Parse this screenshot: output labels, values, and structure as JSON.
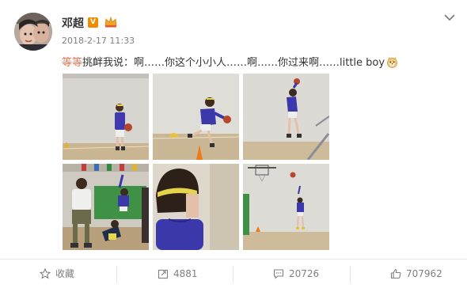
{
  "post": {
    "author": "邓超",
    "verified_badge": "V",
    "timestamp": "2018-2-17 11:33",
    "mention": "等等",
    "text": "挑衅我说：啊……你这个小小人……啊……你过来啊……little boy",
    "colors": {
      "mention": "#eb7350",
      "badge": "#f08a00",
      "text": "#333333",
      "meta": "#808080"
    },
    "photos": [
      {
        "name": "photo-1",
        "subject": "child dribbling basketball"
      },
      {
        "name": "photo-2",
        "subject": "child running with ball near cone"
      },
      {
        "name": "photo-3",
        "subject": "child jumping near hoop"
      },
      {
        "name": "photo-4",
        "subject": "boys playing in gym"
      },
      {
        "name": "photo-5",
        "subject": "close-up of child with headband"
      },
      {
        "name": "photo-6",
        "subject": "child shooting at hoop"
      }
    ]
  },
  "actions": {
    "favorite": "收藏",
    "repost": "4881",
    "comment": "20726",
    "like": "707962"
  }
}
